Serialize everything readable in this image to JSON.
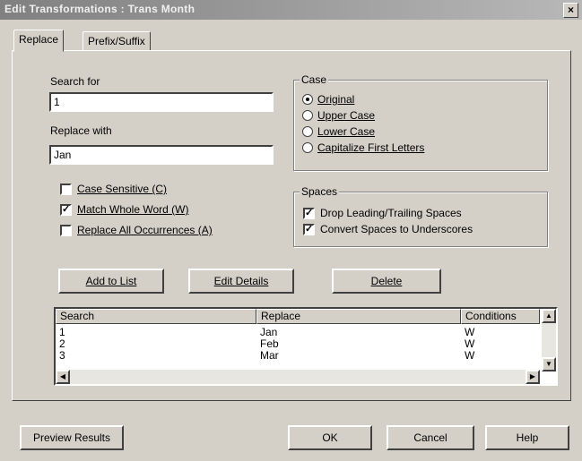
{
  "window": {
    "title": "Edit Transformations : Trans Month",
    "close_glyph": "×"
  },
  "tabs": [
    {
      "label": "Replace"
    },
    {
      "label": "Prefix/Suffix"
    }
  ],
  "search": {
    "label": "Search for",
    "value": "1"
  },
  "replace": {
    "label": "Replace with",
    "value": "Jan"
  },
  "case": {
    "title": "Case",
    "options": [
      {
        "label": "Original",
        "selected": true
      },
      {
        "label": "Upper Case",
        "selected": false
      },
      {
        "label": "Lower Case",
        "selected": false
      },
      {
        "label": "Capitalize First Letters",
        "selected": false
      }
    ]
  },
  "options": [
    {
      "label": "Case Sensitive (C)",
      "checked": false
    },
    {
      "label": "Match Whole Word (W)",
      "checked": true
    },
    {
      "label": "Replace All Occurrences (A)",
      "checked": false
    }
  ],
  "spaces": {
    "title": "Spaces",
    "options": [
      {
        "label": "Drop Leading/Trailing Spaces",
        "checked": true
      },
      {
        "label": "Convert Spaces to Underscores",
        "checked": true
      }
    ]
  },
  "buttons": {
    "add": "Add to List",
    "edit": "Edit Details",
    "delete": "Delete"
  },
  "table": {
    "headers": [
      "Search",
      "Replace",
      "Conditions"
    ],
    "rows": [
      {
        "search": "1",
        "replace": "Jan",
        "conditions": "W"
      },
      {
        "search": "2",
        "replace": "Feb",
        "conditions": "W"
      },
      {
        "search": "3",
        "replace": "Mar",
        "conditions": "W"
      }
    ]
  },
  "footer": {
    "preview": "Preview Results",
    "ok": "OK",
    "cancel": "Cancel",
    "help": "Help"
  },
  "check_glyph": "✓",
  "scroll_glyphs": {
    "up": "▲",
    "down": "▼",
    "left": "◀",
    "right": "▶"
  }
}
